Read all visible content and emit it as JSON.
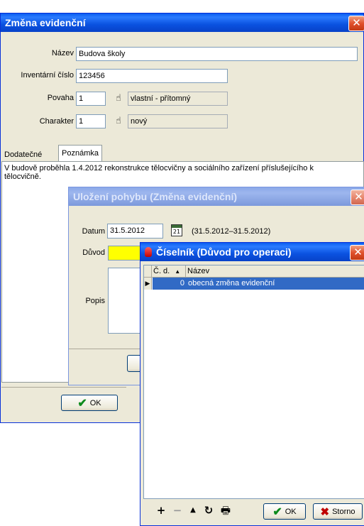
{
  "main_dialog": {
    "title": "Změna evidenční",
    "close_glyph": "✕",
    "labels": {
      "nazev": "Název",
      "inventarni_cislo": "Inventární číslo",
      "povaha": "Povaha",
      "charakter": "Charakter"
    },
    "values": {
      "nazev": "Budova školy",
      "inventarni_cislo": "123456",
      "povaha_code": "1",
      "povaha_text": "vlastní - přítomný",
      "charakter_code": "1",
      "charakter_text": "nový"
    },
    "tabs": [
      {
        "label": "Dodatečné"
      },
      {
        "label": "Poznámka"
      }
    ],
    "note_text": "V budově proběhla 1.4.2012 rekonstrukce tělocvičny a sociálního zařízení příslušejícího k tělocvičně.",
    "ok_label": "OK"
  },
  "save_dialog": {
    "title": "Uložení pohybu (Změna evidenční)",
    "close_glyph": "✕",
    "labels": {
      "datum": "Datum",
      "duvod": "Důvod",
      "popis": "Popis"
    },
    "datum_value": "31.5.2012",
    "date_range": "(31.5.2012–31.5.2012)",
    "calendar_day": "21"
  },
  "codebook_dialog": {
    "title": "Číselník (Důvod pro operaci)",
    "close_glyph": "✕",
    "columns": [
      {
        "label": "Č. d."
      },
      {
        "label": "Název"
      }
    ],
    "sort_indicator": "▲",
    "rows": [
      {
        "code": "0",
        "name": "obecná změna evidenční",
        "selected": true
      }
    ],
    "toolbar": {
      "add": "+",
      "remove": "−",
      "up": "▲",
      "refresh": "↻",
      "print": "🖶"
    },
    "ok_label": "OK",
    "cancel_label": "Storno"
  },
  "colors": {
    "selection": "#316ac5",
    "required_field": "#ffff00",
    "titlebar_active": "#0a52e0",
    "titlebar_inactive": "#8ba8e8"
  }
}
